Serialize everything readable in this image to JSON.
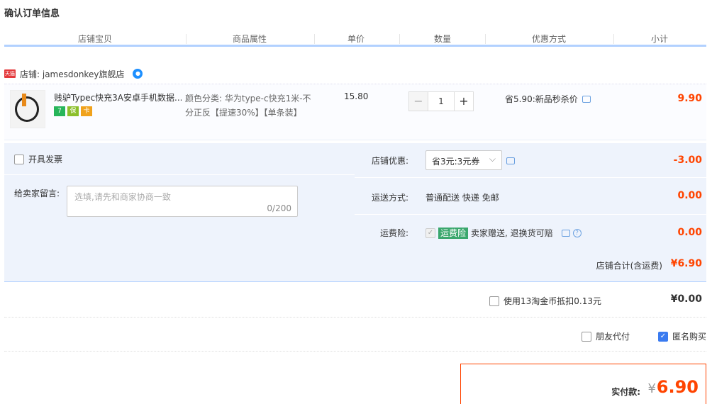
{
  "title": "确认订单信息",
  "columns": [
    "店铺宝贝",
    "商品属性",
    "单价",
    "数量",
    "优惠方式",
    "小计"
  ],
  "shop": {
    "badge": "天猫",
    "name": "店铺: jamesdonkey旗舰店"
  },
  "item": {
    "name": "贱驴Typec快充3A安卓手机数据...",
    "badges": [
      {
        "text": "7",
        "color": "#27b55a"
      },
      {
        "text": "保",
        "color": "#8bbf2a"
      },
      {
        "text": "卡",
        "color": "#f0a21c"
      }
    ],
    "attr": "颜色分类: 华为type-c快充1米-不分正反【提速30%】【单条装】",
    "price": "15.80",
    "quantity": "1",
    "minus": "−",
    "plus": "+",
    "promo": "省5.90:新品秒杀价",
    "subtotal": "9.90"
  },
  "invoice": {
    "label": "开具发票"
  },
  "message": {
    "label": "给卖家留言:",
    "placeholder": "选填,请先和商家协商一致",
    "count": "0/200"
  },
  "shop_discount": {
    "label": "店铺优惠:",
    "selected": "省3元:3元券",
    "value": "-3.00"
  },
  "shipping": {
    "label": "运送方式:",
    "method": "普通配送 快递 免邮",
    "value": "0.00"
  },
  "insurance": {
    "label": "运费险:",
    "badge": "运费险",
    "text": "卖家赠送, 退换货可赔",
    "value": "0.00"
  },
  "shop_total": {
    "label": "店铺合计(含运费)",
    "value": "¥6.90"
  },
  "coins": {
    "label": "使用13淘金币抵扣0.13元",
    "value": "¥0.00"
  },
  "options": {
    "friend_pay": "朋友代付",
    "anonymous": "匿名购买"
  },
  "pay": {
    "label": "实付款:",
    "yen": "¥",
    "value": "6.90"
  },
  "colors": {
    "accent": "#ff4400",
    "panel": "#eef3fc",
    "header_line": "#b2d1ff"
  }
}
